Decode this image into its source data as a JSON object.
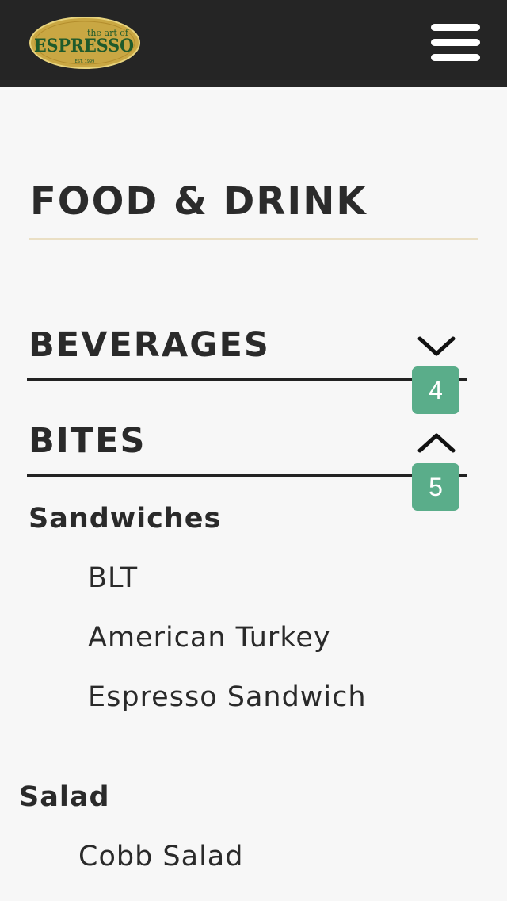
{
  "header": {
    "logo": {
      "line1": "the art of",
      "line2": "ESPRESSO",
      "line3": "EST. 1999"
    },
    "menu_icon": "hamburger-icon"
  },
  "page": {
    "title": "FOOD & DRINK"
  },
  "colors": {
    "topbar": "#252525",
    "background": "#f7f7f7",
    "title_rule": "#eadfc4",
    "badge": "#5aad8a",
    "logo_gold": "#c9a743",
    "logo_green": "#1f5a2b"
  },
  "sections": [
    {
      "label": "BEVERAGES",
      "expanded": false,
      "icon": "chevron-down-icon",
      "badge": "4"
    },
    {
      "label": "BITES",
      "expanded": true,
      "icon": "chevron-up-icon",
      "badge": "5",
      "groups": [
        {
          "heading": "Sandwiches",
          "items": [
            "BLT",
            "American Turkey",
            "Espresso Sandwich"
          ]
        },
        {
          "heading": "Salad",
          "items": [
            "Cobb Salad"
          ]
        }
      ]
    }
  ]
}
